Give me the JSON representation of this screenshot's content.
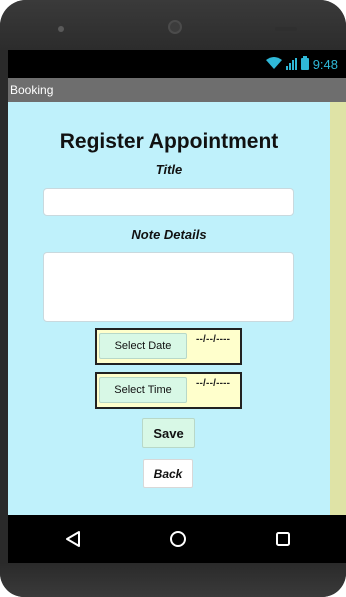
{
  "status_bar": {
    "time": "9:48",
    "icons": [
      "wifi-icon",
      "signal-icon",
      "battery-icon"
    ],
    "accent_color": "#2fb8d8"
  },
  "app": {
    "title": "Booking"
  },
  "form": {
    "heading": "Register Appointment",
    "title_label": "Title",
    "title_value": "",
    "notes_label": "Note Details",
    "notes_value": "",
    "date_button": "Select Date",
    "date_value": "--/--/----",
    "time_button": "Select Time",
    "time_value": "--/--/----",
    "save_button": "Save",
    "back_button": "Back"
  },
  "colors": {
    "content_background": "#bff1fb",
    "side_strip": "#dfe3a6",
    "picker_background": "#ffffcc",
    "button_background": "#d8f8e6",
    "title_bar": "#6e6e6e"
  },
  "nav_bar": {
    "icons": [
      "back-triangle-icon",
      "home-circle-icon",
      "recents-square-icon"
    ]
  }
}
